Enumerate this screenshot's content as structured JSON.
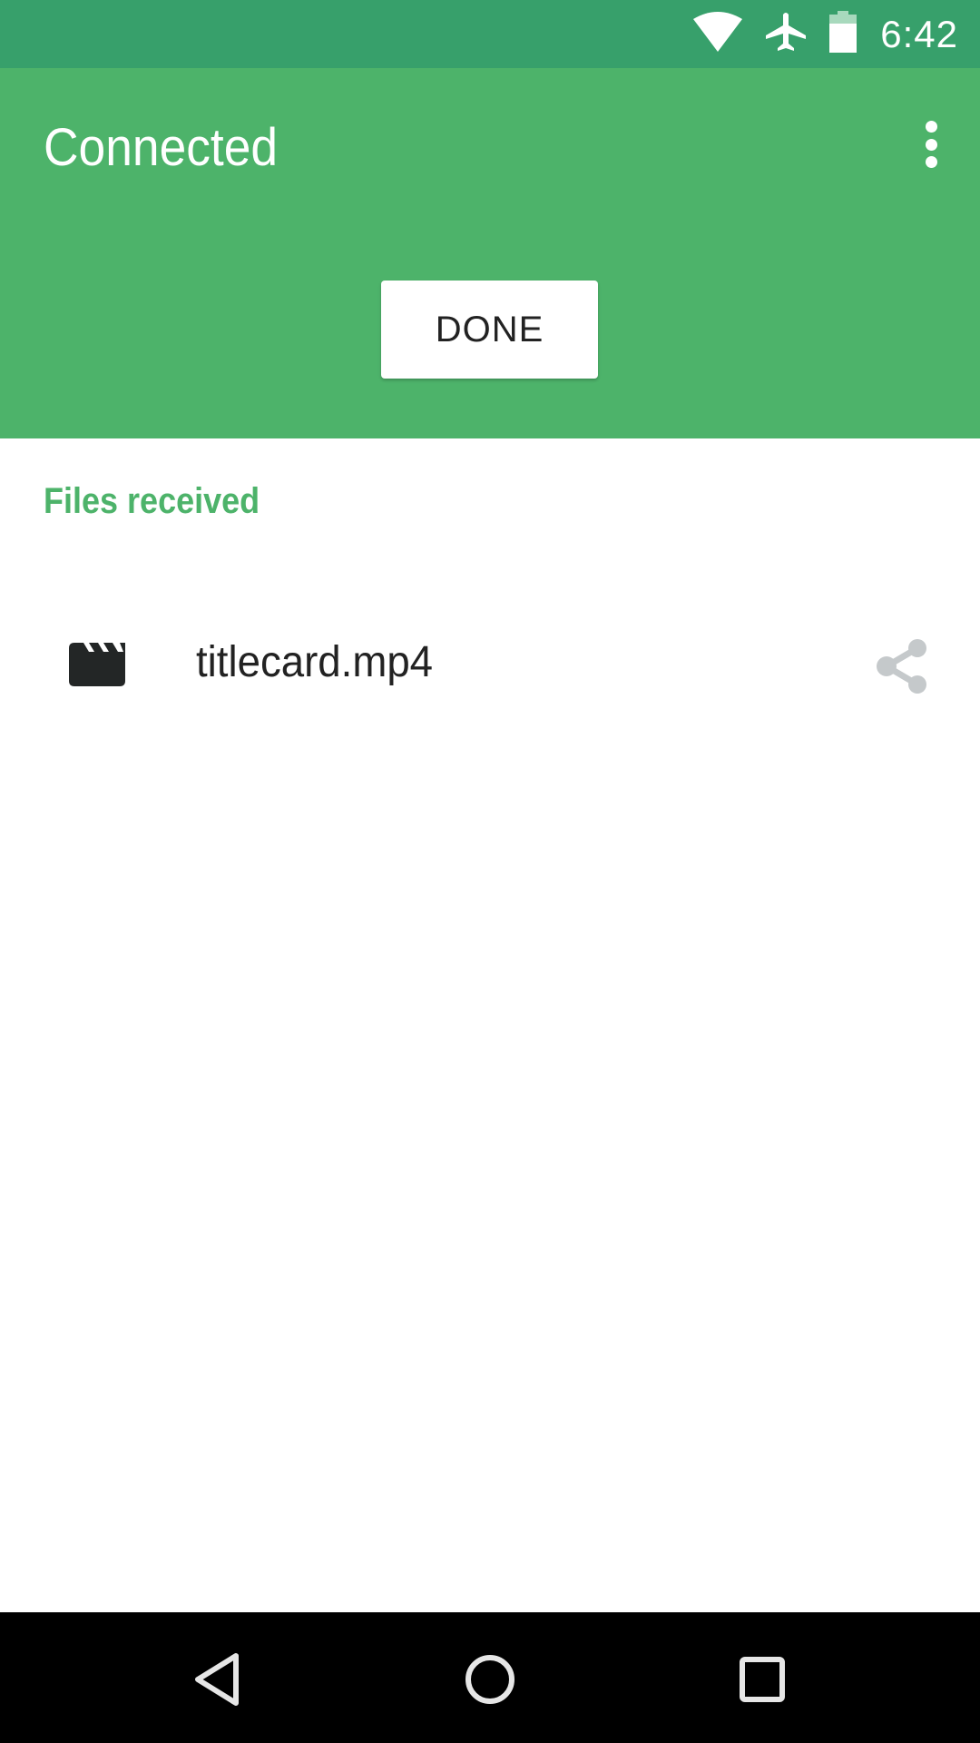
{
  "status_bar": {
    "time": "6:42",
    "icons": [
      "wifi-icon",
      "airplane-mode-icon",
      "battery-icon"
    ]
  },
  "app_bar": {
    "title": "Connected",
    "menu_icon": "more-vert-icon",
    "done_label": "DONE",
    "color": "#4db36a"
  },
  "content": {
    "section_label": "Files received",
    "files": [
      {
        "name": "titlecard.mp4",
        "type_icon": "movie-clapperboard-icon",
        "action_icon": "share-icon"
      }
    ]
  },
  "nav_bar": {
    "buttons": [
      "back",
      "home",
      "recents"
    ]
  },
  "colors": {
    "status_bar": "#37a06b",
    "accent": "#4db36a",
    "share_icon": "#c5c9cb"
  }
}
